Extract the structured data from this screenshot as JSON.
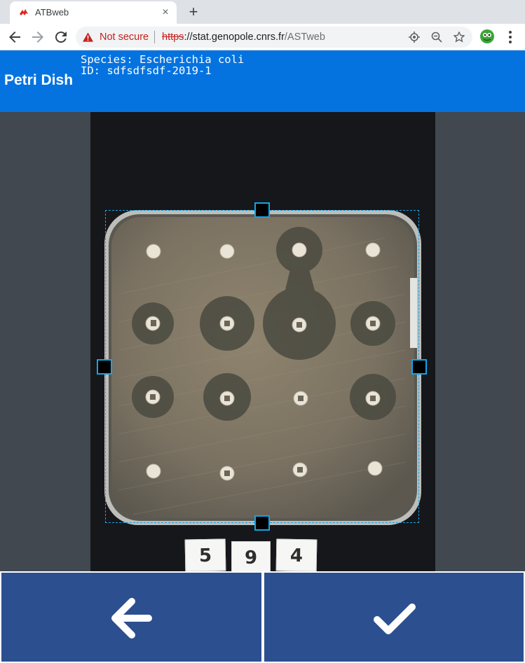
{
  "browser": {
    "tab_title": "ATBweb",
    "tab_close": "×",
    "new_tab": "+",
    "security_label": "Not secure",
    "url_scheme": "https",
    "url_host": "://stat.genopole.cnrs.fr",
    "url_path": "/ASTweb"
  },
  "header": {
    "title": "Petri Dish",
    "species_line": "Species: Escherichia coli",
    "id_line": "ID: sdfsdfsdf-2019-1"
  },
  "plate_labels": [
    "5",
    "9",
    "4"
  ],
  "colors": {
    "header_bg": "#0473e0",
    "button_bg": "#2c4f8f",
    "crop_accent": "#13a4e6",
    "backdrop": "#424850"
  },
  "buttons": {
    "back_icon": "arrow-left-icon",
    "confirm_icon": "checkmark-icon"
  }
}
